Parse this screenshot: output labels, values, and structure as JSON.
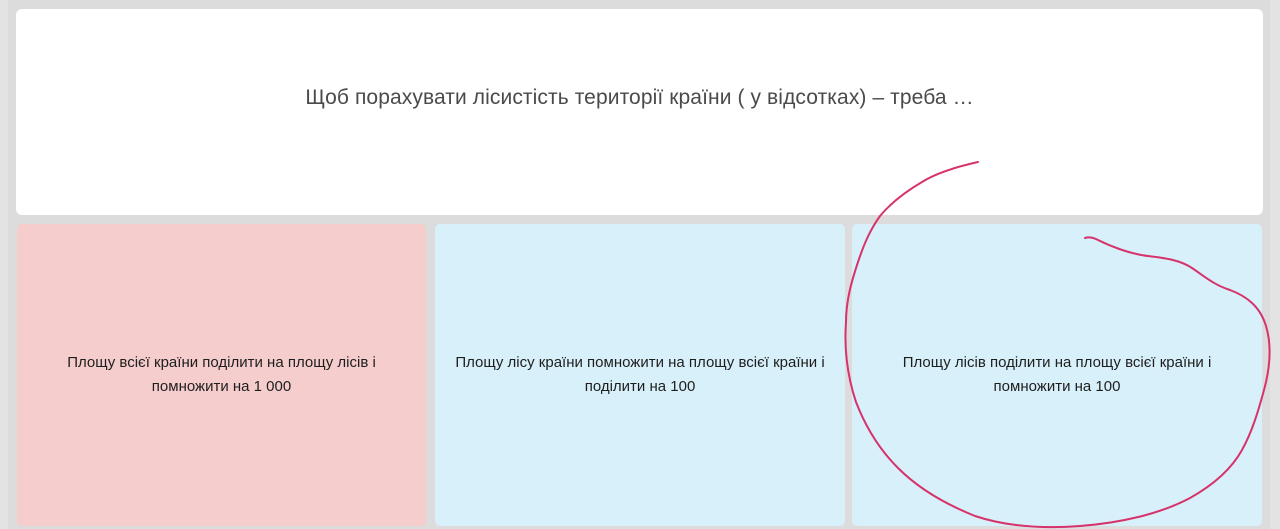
{
  "question": {
    "text": "Щоб порахувати лісистість території країни ( у відсотках) – треба …"
  },
  "answers": [
    {
      "text": "Площу всієї країни поділити на площу лісів і помножити на 1 000",
      "color": "#f6cdcd"
    },
    {
      "text": "Площу лісу країни помножити на площу всієї країни і поділити на 100",
      "color": "#fae1b9"
    },
    {
      "text": "Площу лісів поділити на площу всієї країни і помножити на 100",
      "color": "#d8f0fa"
    }
  ],
  "annotation": {
    "color": "#d6336c",
    "circled_answer": 3
  }
}
